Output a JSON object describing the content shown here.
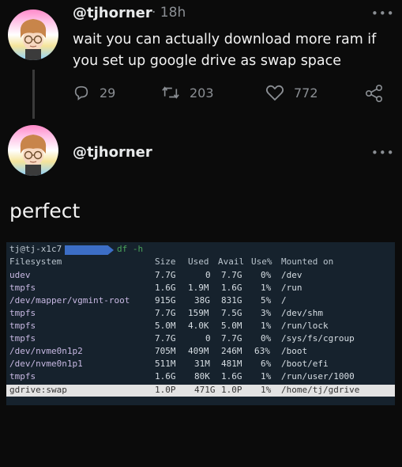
{
  "tweet1": {
    "handle": "@tjhorner",
    "time": "· 18h",
    "more": "•••",
    "text": "wait you can actually download more ram if you set up google drive as swap space",
    "replies": "29",
    "retweets": "203",
    "likes": "772"
  },
  "tweet2": {
    "handle": "@tjhorner",
    "more": "•••",
    "text": "perfect"
  },
  "terminal": {
    "prompt_user": "tj@tj-x1c7",
    "command": "df -h",
    "headers": {
      "filesystem": "Filesystem",
      "size": "Size",
      "used": "Used",
      "avail": "Avail",
      "usep": "Use%",
      "mounted": "Mounted on"
    },
    "rows": [
      {
        "fs": "udev",
        "size": "7.7G",
        "used": "0",
        "avail": "7.7G",
        "usep": "0%",
        "mount": "/dev"
      },
      {
        "fs": "tmpfs",
        "size": "1.6G",
        "used": "1.9M",
        "avail": "1.6G",
        "usep": "1%",
        "mount": "/run"
      },
      {
        "fs": "/dev/mapper/vgmint-root",
        "size": "915G",
        "used": "38G",
        "avail": "831G",
        "usep": "5%",
        "mount": "/"
      },
      {
        "fs": "tmpfs",
        "size": "7.7G",
        "used": "159M",
        "avail": "7.5G",
        "usep": "3%",
        "mount": "/dev/shm"
      },
      {
        "fs": "tmpfs",
        "size": "5.0M",
        "used": "4.0K",
        "avail": "5.0M",
        "usep": "1%",
        "mount": "/run/lock"
      },
      {
        "fs": "tmpfs",
        "size": "7.7G",
        "used": "0",
        "avail": "7.7G",
        "usep": "0%",
        "mount": "/sys/fs/cgroup"
      },
      {
        "fs": "/dev/nvme0n1p2",
        "size": "705M",
        "used": "409M",
        "avail": "246M",
        "usep": "63%",
        "mount": "/boot"
      },
      {
        "fs": "/dev/nvme0n1p1",
        "size": "511M",
        "used": "31M",
        "avail": "481M",
        "usep": "6%",
        "mount": "/boot/efi"
      },
      {
        "fs": "tmpfs",
        "size": "1.6G",
        "used": "80K",
        "avail": "1.6G",
        "usep": "1%",
        "mount": "/run/user/1000"
      },
      {
        "fs": "gdrive:swap",
        "size": "1.0P",
        "used": "471G",
        "avail": "1.0P",
        "usep": "1%",
        "mount": "/home/tj/gdrive"
      }
    ]
  },
  "icons": {
    "reply": "reply-icon",
    "retweet": "retweet-icon",
    "like": "heart-icon",
    "share": "share-icon"
  },
  "colors": {
    "background": "#0b0b0b",
    "muted": "#8b8f94",
    "terminal_bg": "#16222d",
    "prompt_arrow": "#3c6ec6",
    "command": "#4aa35a"
  }
}
